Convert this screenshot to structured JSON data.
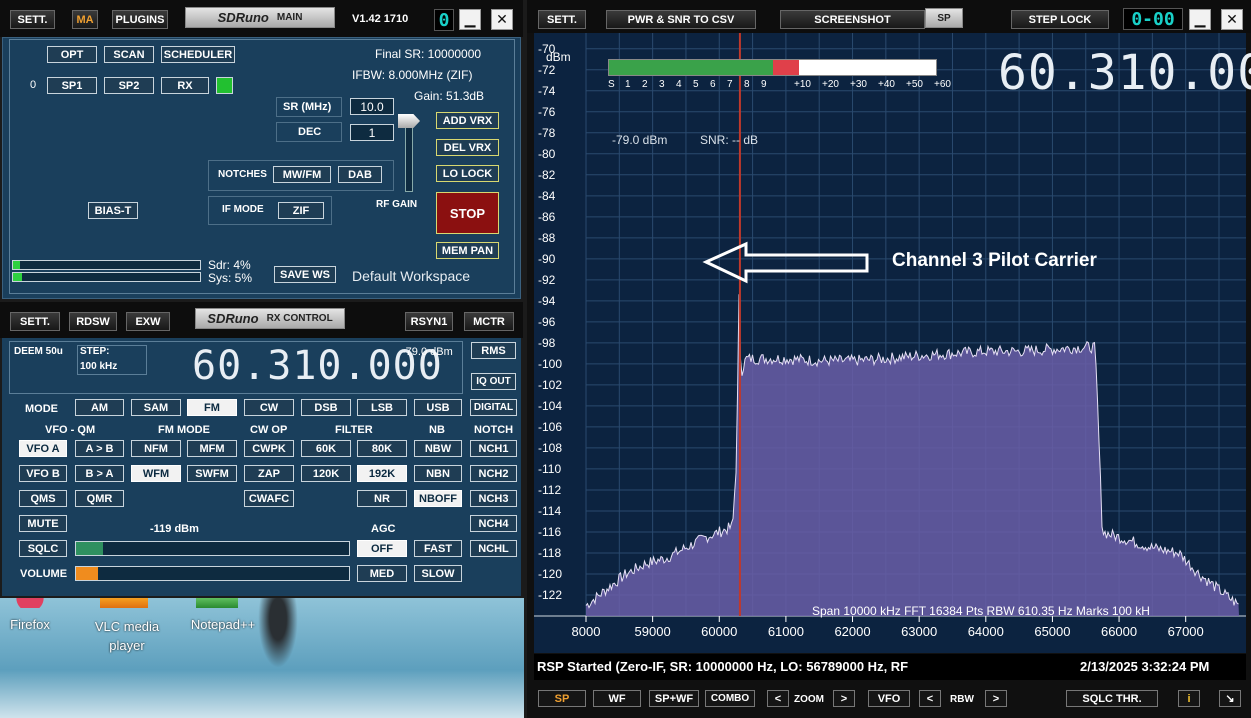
{
  "main": {
    "sett": "SETT.",
    "ma": "MA",
    "plugins": "PLUGINS",
    "title": "SDRuno",
    "title_sub": "MAIN",
    "version": "V1.42 1710",
    "digit": "0",
    "opt": "OPT",
    "scan": "SCAN",
    "scheduler": "SCHEDULER",
    "zero": "0",
    "sp1": "SP1",
    "sp2": "SP2",
    "rx": "RX",
    "final_sr": "Final SR: 10000000",
    "ifbw": "IFBW: 8.000MHz (ZIF)",
    "gain": "Gain: 51.3dB",
    "sr_label": "SR (MHz)",
    "sr_value": "10.0",
    "dec_label": "DEC",
    "dec_value": "1",
    "add_vrx": "ADD VRX",
    "del_vrx": "DEL VRX",
    "lo_lock": "LO LOCK",
    "stop": "STOP",
    "mem_pan": "MEM PAN",
    "notches_label": "NOTCHES",
    "mwfm": "MW/FM",
    "dab": "DAB",
    "if_mode_label": "IF MODE",
    "zif": "ZIF",
    "rf_gain": "RF GAIN",
    "bias_t": "BIAS-T",
    "sdr_load": "Sdr: 4%",
    "sys_load": "Sys: 5%",
    "save_ws": "SAVE WS",
    "workspace": "Default Workspace"
  },
  "rx": {
    "sett": "SETT.",
    "rdsw": "RDSW",
    "exw": "EXW",
    "title": "SDRuno",
    "title_sub": "RX CONTROL",
    "rsyn1": "RSYN1",
    "mctr": "MCTR",
    "deem": "DEEM 50u",
    "step_label": "STEP:",
    "step_value": "100 kHz",
    "frequency": "60.310.000",
    "signal": "-79.0 dBm",
    "rms": "RMS",
    "iq_out": "IQ OUT",
    "mode_label": "MODE",
    "modes": [
      "AM",
      "SAM",
      "FM",
      "CW",
      "DSB",
      "LSB",
      "USB",
      "DIGITAL"
    ],
    "vfo_qm": "VFO - QM",
    "fm_mode": "FM MODE",
    "cw_op": "CW OP",
    "filter": "FILTER",
    "nb": "NB",
    "notch": "NOTCH",
    "vfo_a": "VFO A",
    "a_to_b": "A > B",
    "nfm": "NFM",
    "mfm": "MFM",
    "cwpk": "CWPK",
    "f60k": "60K",
    "f80k": "80K",
    "nbw": "NBW",
    "nch1": "NCH1",
    "vfo_b": "VFO B",
    "b_to_a": "B > A",
    "wfm": "WFM",
    "swfm": "SWFM",
    "zap": "ZAP",
    "f120k": "120K",
    "f192k": "192K",
    "nbn": "NBN",
    "nch2": "NCH2",
    "qms": "QMS",
    "qmr": "QMR",
    "cwafc": "CWAFC",
    "nr": "NR",
    "nboff": "NBOFF",
    "nch3": "NCH3",
    "mute": "MUTE",
    "nch4": "NCH4",
    "squelch_level": "-119 dBm",
    "agc": "AGC",
    "sqlc": "SQLC",
    "agc_off": "OFF",
    "agc_fast": "FAST",
    "nchl": "NCHL",
    "volume": "VOLUME",
    "agc_med": "MED",
    "agc_slow": "SLOW"
  },
  "desktop": {
    "icons": [
      {
        "label": "Firefox"
      },
      {
        "label": "VLC media player"
      },
      {
        "label": "Notepad++"
      }
    ]
  },
  "spectrum": {
    "sett": "SETT.",
    "pwr_snr": "PWR & SNR TO CSV",
    "screenshot": "SCREENSHOT",
    "sp_tab": "SP",
    "step_lock": "STEP LOCK",
    "digit": "0-00",
    "dbm_unit": "dBm",
    "frequency": "60.310.000",
    "marker_readout": "-79.0 dBm",
    "snr_readout": "SNR: -- dB",
    "s_scale": [
      "S",
      "1",
      "2",
      "3",
      "4",
      "5",
      "6",
      "7",
      "8",
      "9",
      "+10",
      "+20",
      "+30",
      "+40",
      "+50",
      "+60"
    ],
    "s_meter_level_pct": 50,
    "s_meter_red_pct": 8,
    "annotation": "Channel 3 Pilot Carrier",
    "span_info": "Span 10000 kHz   FFT 16384 Pts   RBW 610.35 Hz   Marks 100 kH",
    "status": "RSP Started (Zero-IF, SR: 10000000 Hz, LO: 56789000 Hz, RF",
    "datetime": "2/13/2025 3:32:24 PM",
    "bottom": {
      "sp": "SP",
      "wf": "WF",
      "spwf": "SP+WF",
      "combo": "COMBO",
      "zoom": "ZOOM",
      "vfo": "VFO",
      "rbw": "RBW",
      "sqlc_thr": "SQLC THR.",
      "info": "i"
    },
    "colors": {
      "grid": "#2a4a6e",
      "fill": "#6a5ea8",
      "trace": "#e6e0f4",
      "marker": "#c0392b",
      "bg": "#0c2340",
      "smeter_green": "#3aa24a",
      "smeter_red": "#e0404a"
    }
  },
  "chart_data": {
    "type": "area",
    "xlabel": "",
    "ylabel": "dBm",
    "xlim": [
      58000,
      67800
    ],
    "ylim": [
      -124,
      -68.5
    ],
    "x_ticks": [
      58000,
      59000,
      60000,
      61000,
      62000,
      63000,
      64000,
      65000,
      66000,
      67000
    ],
    "x_tick_labels": [
      "8000",
      "59000",
      "60000",
      "61000",
      "62000",
      "63000",
      "64000",
      "65000",
      "66000",
      "67000"
    ],
    "y_ticks": [
      -70,
      -72,
      -74,
      -76,
      -78,
      -80,
      -82,
      -84,
      -86,
      -88,
      -90,
      -92,
      -94,
      -96,
      -98,
      -100,
      -102,
      -104,
      -106,
      -108,
      -110,
      -112,
      -114,
      -116,
      -118,
      -120,
      -122
    ],
    "marker_khz": 60310,
    "series": [
      {
        "x": [
          58000,
          58300,
          58600,
          58900,
          59200,
          59500,
          59800,
          60000,
          60200,
          60260,
          60310,
          60320,
          60400,
          61000,
          61500,
          62000,
          62500,
          63000,
          63500,
          64000,
          64500,
          65000,
          65500,
          65630,
          65660,
          65750,
          66000,
          66500,
          66900,
          67200,
          67500,
          67800
        ],
        "values": [
          -123,
          -121.5,
          -120,
          -119,
          -118.5,
          -117.5,
          -116.5,
          -116,
          -115.5,
          -109,
          -88,
          -101,
          -99.5,
          -99.5,
          -99.7,
          -99.7,
          -99.5,
          -99.2,
          -99,
          -98.8,
          -98.8,
          -98.6,
          -98.4,
          -98.4,
          -101,
          -116,
          -116.5,
          -117.5,
          -118,
          -120,
          -121.5,
          -123
        ]
      }
    ]
  }
}
